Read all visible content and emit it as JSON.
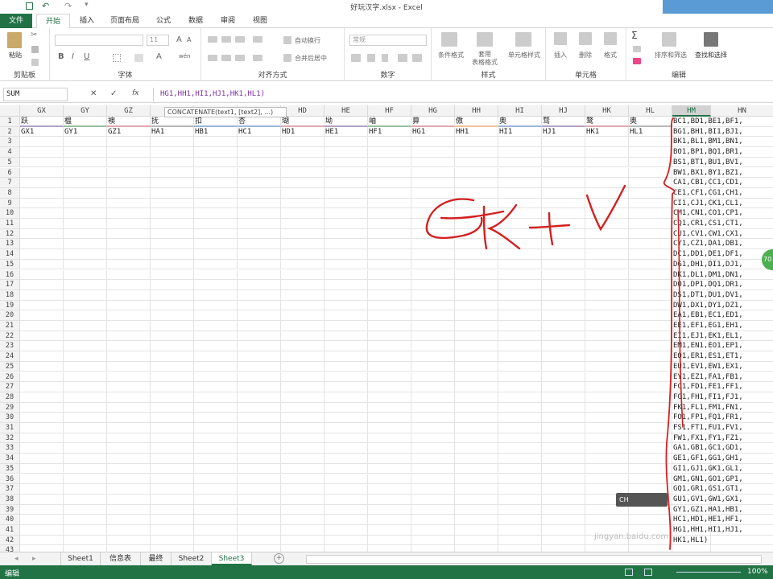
{
  "app": {
    "title": "好玩汉字.xlsx - Excel"
  },
  "tabs": [
    "文件",
    "开始",
    "插入",
    "页面布局",
    "公式",
    "数据",
    "审阅",
    "视图"
  ],
  "ribbon": {
    "clipboard": {
      "paste": "粘贴",
      "label": "剪贴板"
    },
    "font": {
      "name": "",
      "size": "11",
      "label": "字体",
      "bold": "B",
      "italic": "I",
      "underline": "U",
      "grow": "A",
      "shrink": "A",
      "color_a": "A",
      "wen": "wén"
    },
    "align": {
      "wrap": "自动换行",
      "merge": "合并后居中",
      "label": "对齐方式"
    },
    "number": {
      "format": "常规",
      "label": "数字"
    },
    "styles": {
      "cond": "条件格式",
      "table": "套用\n表格格式",
      "cell": "单元格样式",
      "label": "样式"
    },
    "cells": {
      "insert": "插入",
      "delete": "删除",
      "format": "格式",
      "label": "单元格"
    },
    "edit": {
      "sigma": "Σ",
      "sort": "排序和筛选",
      "find": "查找和选择",
      "label": "编辑"
    }
  },
  "formula_bar": {
    "name_box": "SUM",
    "fx": "fx",
    "formula": "HG1,HH1,HI1,HJ1,HK1,HL1)"
  },
  "tooltip": "CONCATENATE(text1, [text2], ...)",
  "columns": [
    "GX",
    "GY",
    "GZ",
    "HA",
    "HB",
    "HC",
    "HD",
    "HE",
    "HF",
    "HG",
    "HH",
    "HI",
    "HJ",
    "HK",
    "HL",
    "HM",
    "HN"
  ],
  "row1": [
    "跃",
    "榅",
    "襖",
    "抚",
    "扣",
    "杏",
    "瑚",
    "坳",
    "岫",
    "萛",
    "傲",
    "奥",
    "骛",
    "鹜",
    "奥"
  ],
  "row2": [
    "GX1",
    "GY1",
    "GZ1",
    "HA1",
    "HB1",
    "HC1",
    "HD1",
    "HE1",
    "HF1",
    "HG1",
    "HH1",
    "HI1",
    "HJ1",
    "HK1",
    "HL1"
  ],
  "row_numbers": [
    "1",
    "2",
    "3",
    "4",
    "5",
    "6",
    "7",
    "8",
    "9",
    "10",
    "11",
    "12",
    "13",
    "14",
    "15",
    "16",
    "17",
    "18",
    "19",
    "20",
    "21",
    "22",
    "23",
    "24",
    "25",
    "26",
    "27",
    "28",
    "29",
    "30",
    "31",
    "32",
    "33",
    "34",
    "35",
    "36",
    "37",
    "38",
    "39",
    "40",
    "41",
    "42",
    "43"
  ],
  "hn_column": [
    "BC1,BD1,BE1,BF1,",
    "BG1,BH1,BI1,BJ1,",
    "BK1,BL1,BM1,BN1,",
    "BO1,BP1,BQ1,BR1,",
    "BS1,BT1,BU1,BV1,",
    "BW1,BX1,BY1,BZ1,",
    "CA1,CB1,CC1,CD1,",
    "CE1,CF1,CG1,CH1,",
    "CI1,CJ1,CK1,CL1,",
    "CM1,CN1,CO1,CP1,",
    "CQ1,CR1,CS1,CT1,",
    "CU1,CV1,CW1,CX1,",
    "CY1,CZ1,DA1,DB1,",
    "DC1,DD1,DE1,DF1,",
    "DG1,DH1,DI1,DJ1,",
    "DK1,DL1,DM1,DN1,",
    "DO1,DP1,DQ1,DR1,",
    "DS1,DT1,DU1,DV1,",
    "DW1,DX1,DY1,DZ1,",
    "EA1,EB1,EC1,ED1,",
    "EE1,EF1,EG1,EH1,",
    "EI1,EJ1,EK1,EL1,",
    "EM1,EN1,EO1,EP1,",
    "EQ1,ER1,ES1,ET1,",
    "EU1,EV1,EW1,EX1,",
    "EY1,EZ1,FA1,FB1,",
    "FC1,FD1,FE1,FF1,",
    "FG1,FH1,FI1,FJ1,",
    "FK1,FL1,FM1,FN1,",
    "FO1,FP1,FQ1,FR1,",
    "FS1,FT1,FU1,FV1,",
    "FW1,FX1,FY1,FZ1,",
    "GA1,GB1,GC1,GD1,",
    "GE1,GF1,GG1,GH1,",
    "GI1,GJ1,GK1,GL1,",
    "GM1,GN1,GO1,GP1,",
    "GQ1,GR1,GS1,GT1,",
    "GU1,GV1,GW1,GX1,",
    "GY1,GZ1,HA1,HB1,",
    "HC1,HD1,HE1,HF1,",
    "HG1,HH1,HI1,HJ1,",
    "HK1,HL1)",
    ""
  ],
  "sheets": [
    "Sheet1",
    "信息表",
    "最终",
    "Sheet2",
    "Sheet3"
  ],
  "active_sheet": "Sheet3",
  "status": {
    "mode": "编辑",
    "zoom": "100%"
  },
  "mini_toolbar": "CH",
  "badge": "70",
  "watermark": "jingyan.baidu.com",
  "colors": {
    "excel_green": "#217346",
    "ink_red": "#d42020",
    "accent_blue": "#5b9bd5"
  }
}
